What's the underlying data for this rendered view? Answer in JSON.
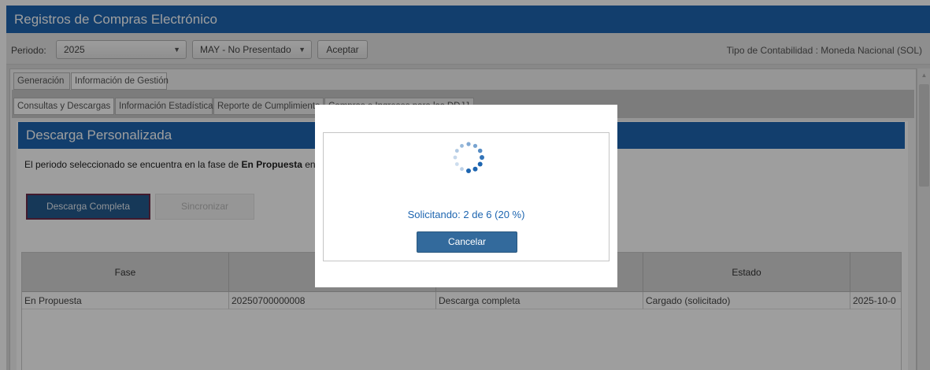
{
  "app": {
    "title": "Registros de Compras Electrónico"
  },
  "period": {
    "label": "Periodo:",
    "year_value": "2025",
    "month_value": "MAY - No Presentado",
    "accept_label": "Aceptar",
    "contabilidad": "Tipo de Contabilidad : Moneda Nacional (SOL)"
  },
  "tabs_top": [
    "Generación",
    "Información de Gestión"
  ],
  "tabs_sub": [
    "Consultas y Descargas",
    "Información Estadística",
    "Reporte de Cumplimiento",
    "Compras e Ingresos para las DDJJ"
  ],
  "panel": {
    "title": "Descarga Personalizada",
    "fase_prefix": "El periodo seleccionado se encuentra en la fase de ",
    "fase_bold": "En Propuesta",
    "fase_suffix": " en el po",
    "btn_descarga": "Descarga Completa",
    "btn_sincronizar": "Sincronizar"
  },
  "table": {
    "headers": [
      "Fase",
      "",
      "",
      "Estado",
      ""
    ],
    "rows": [
      [
        "En Propuesta",
        "20250700000008",
        "Descarga completa",
        "Cargado (solicitado)",
        "2025-10-0"
      ]
    ]
  },
  "modal": {
    "status": "Solicitando: 2 de 6 (20 %)",
    "progress_pct": 20,
    "cancel_label": "Cancelar"
  },
  "colors": {
    "accent": "#1d65b0",
    "button_dark": "#336a9c"
  },
  "icons": {
    "spinner": "loading-spinner-icon"
  }
}
